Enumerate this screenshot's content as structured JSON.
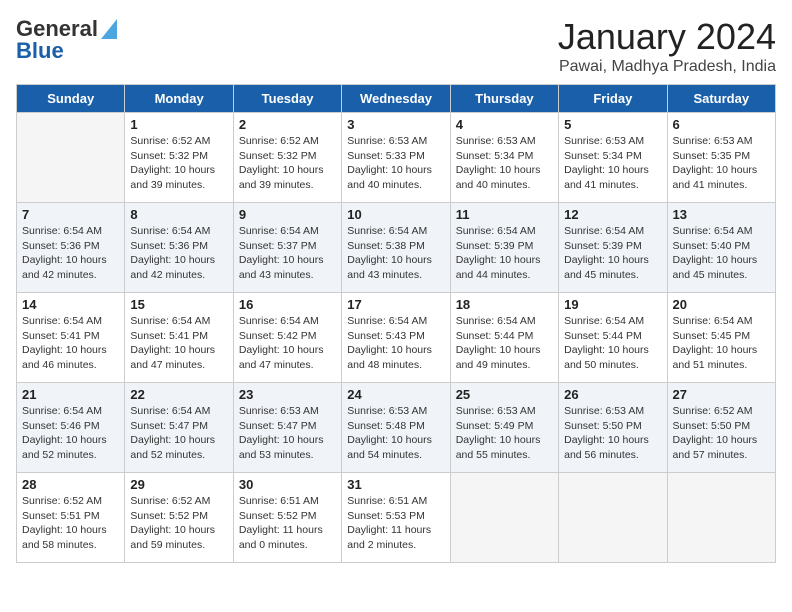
{
  "logo": {
    "line1": "General",
    "line2": "Blue"
  },
  "title": "January 2024",
  "location": "Pawai, Madhya Pradesh, India",
  "weekdays": [
    "Sunday",
    "Monday",
    "Tuesday",
    "Wednesday",
    "Thursday",
    "Friday",
    "Saturday"
  ],
  "weeks": [
    [
      {
        "day": "",
        "info": ""
      },
      {
        "day": "1",
        "info": "Sunrise: 6:52 AM\nSunset: 5:32 PM\nDaylight: 10 hours\nand 39 minutes."
      },
      {
        "day": "2",
        "info": "Sunrise: 6:52 AM\nSunset: 5:32 PM\nDaylight: 10 hours\nand 39 minutes."
      },
      {
        "day": "3",
        "info": "Sunrise: 6:53 AM\nSunset: 5:33 PM\nDaylight: 10 hours\nand 40 minutes."
      },
      {
        "day": "4",
        "info": "Sunrise: 6:53 AM\nSunset: 5:34 PM\nDaylight: 10 hours\nand 40 minutes."
      },
      {
        "day": "5",
        "info": "Sunrise: 6:53 AM\nSunset: 5:34 PM\nDaylight: 10 hours\nand 41 minutes."
      },
      {
        "day": "6",
        "info": "Sunrise: 6:53 AM\nSunset: 5:35 PM\nDaylight: 10 hours\nand 41 minutes."
      }
    ],
    [
      {
        "day": "7",
        "info": "Sunrise: 6:54 AM\nSunset: 5:36 PM\nDaylight: 10 hours\nand 42 minutes."
      },
      {
        "day": "8",
        "info": "Sunrise: 6:54 AM\nSunset: 5:36 PM\nDaylight: 10 hours\nand 42 minutes."
      },
      {
        "day": "9",
        "info": "Sunrise: 6:54 AM\nSunset: 5:37 PM\nDaylight: 10 hours\nand 43 minutes."
      },
      {
        "day": "10",
        "info": "Sunrise: 6:54 AM\nSunset: 5:38 PM\nDaylight: 10 hours\nand 43 minutes."
      },
      {
        "day": "11",
        "info": "Sunrise: 6:54 AM\nSunset: 5:39 PM\nDaylight: 10 hours\nand 44 minutes."
      },
      {
        "day": "12",
        "info": "Sunrise: 6:54 AM\nSunset: 5:39 PM\nDaylight: 10 hours\nand 45 minutes."
      },
      {
        "day": "13",
        "info": "Sunrise: 6:54 AM\nSunset: 5:40 PM\nDaylight: 10 hours\nand 45 minutes."
      }
    ],
    [
      {
        "day": "14",
        "info": "Sunrise: 6:54 AM\nSunset: 5:41 PM\nDaylight: 10 hours\nand 46 minutes."
      },
      {
        "day": "15",
        "info": "Sunrise: 6:54 AM\nSunset: 5:41 PM\nDaylight: 10 hours\nand 47 minutes."
      },
      {
        "day": "16",
        "info": "Sunrise: 6:54 AM\nSunset: 5:42 PM\nDaylight: 10 hours\nand 47 minutes."
      },
      {
        "day": "17",
        "info": "Sunrise: 6:54 AM\nSunset: 5:43 PM\nDaylight: 10 hours\nand 48 minutes."
      },
      {
        "day": "18",
        "info": "Sunrise: 6:54 AM\nSunset: 5:44 PM\nDaylight: 10 hours\nand 49 minutes."
      },
      {
        "day": "19",
        "info": "Sunrise: 6:54 AM\nSunset: 5:44 PM\nDaylight: 10 hours\nand 50 minutes."
      },
      {
        "day": "20",
        "info": "Sunrise: 6:54 AM\nSunset: 5:45 PM\nDaylight: 10 hours\nand 51 minutes."
      }
    ],
    [
      {
        "day": "21",
        "info": "Sunrise: 6:54 AM\nSunset: 5:46 PM\nDaylight: 10 hours\nand 52 minutes."
      },
      {
        "day": "22",
        "info": "Sunrise: 6:54 AM\nSunset: 5:47 PM\nDaylight: 10 hours\nand 52 minutes."
      },
      {
        "day": "23",
        "info": "Sunrise: 6:53 AM\nSunset: 5:47 PM\nDaylight: 10 hours\nand 53 minutes."
      },
      {
        "day": "24",
        "info": "Sunrise: 6:53 AM\nSunset: 5:48 PM\nDaylight: 10 hours\nand 54 minutes."
      },
      {
        "day": "25",
        "info": "Sunrise: 6:53 AM\nSunset: 5:49 PM\nDaylight: 10 hours\nand 55 minutes."
      },
      {
        "day": "26",
        "info": "Sunrise: 6:53 AM\nSunset: 5:50 PM\nDaylight: 10 hours\nand 56 minutes."
      },
      {
        "day": "27",
        "info": "Sunrise: 6:52 AM\nSunset: 5:50 PM\nDaylight: 10 hours\nand 57 minutes."
      }
    ],
    [
      {
        "day": "28",
        "info": "Sunrise: 6:52 AM\nSunset: 5:51 PM\nDaylight: 10 hours\nand 58 minutes."
      },
      {
        "day": "29",
        "info": "Sunrise: 6:52 AM\nSunset: 5:52 PM\nDaylight: 10 hours\nand 59 minutes."
      },
      {
        "day": "30",
        "info": "Sunrise: 6:51 AM\nSunset: 5:52 PM\nDaylight: 11 hours\nand 0 minutes."
      },
      {
        "day": "31",
        "info": "Sunrise: 6:51 AM\nSunset: 5:53 PM\nDaylight: 11 hours\nand 2 minutes."
      },
      {
        "day": "",
        "info": ""
      },
      {
        "day": "",
        "info": ""
      },
      {
        "day": "",
        "info": ""
      }
    ]
  ]
}
